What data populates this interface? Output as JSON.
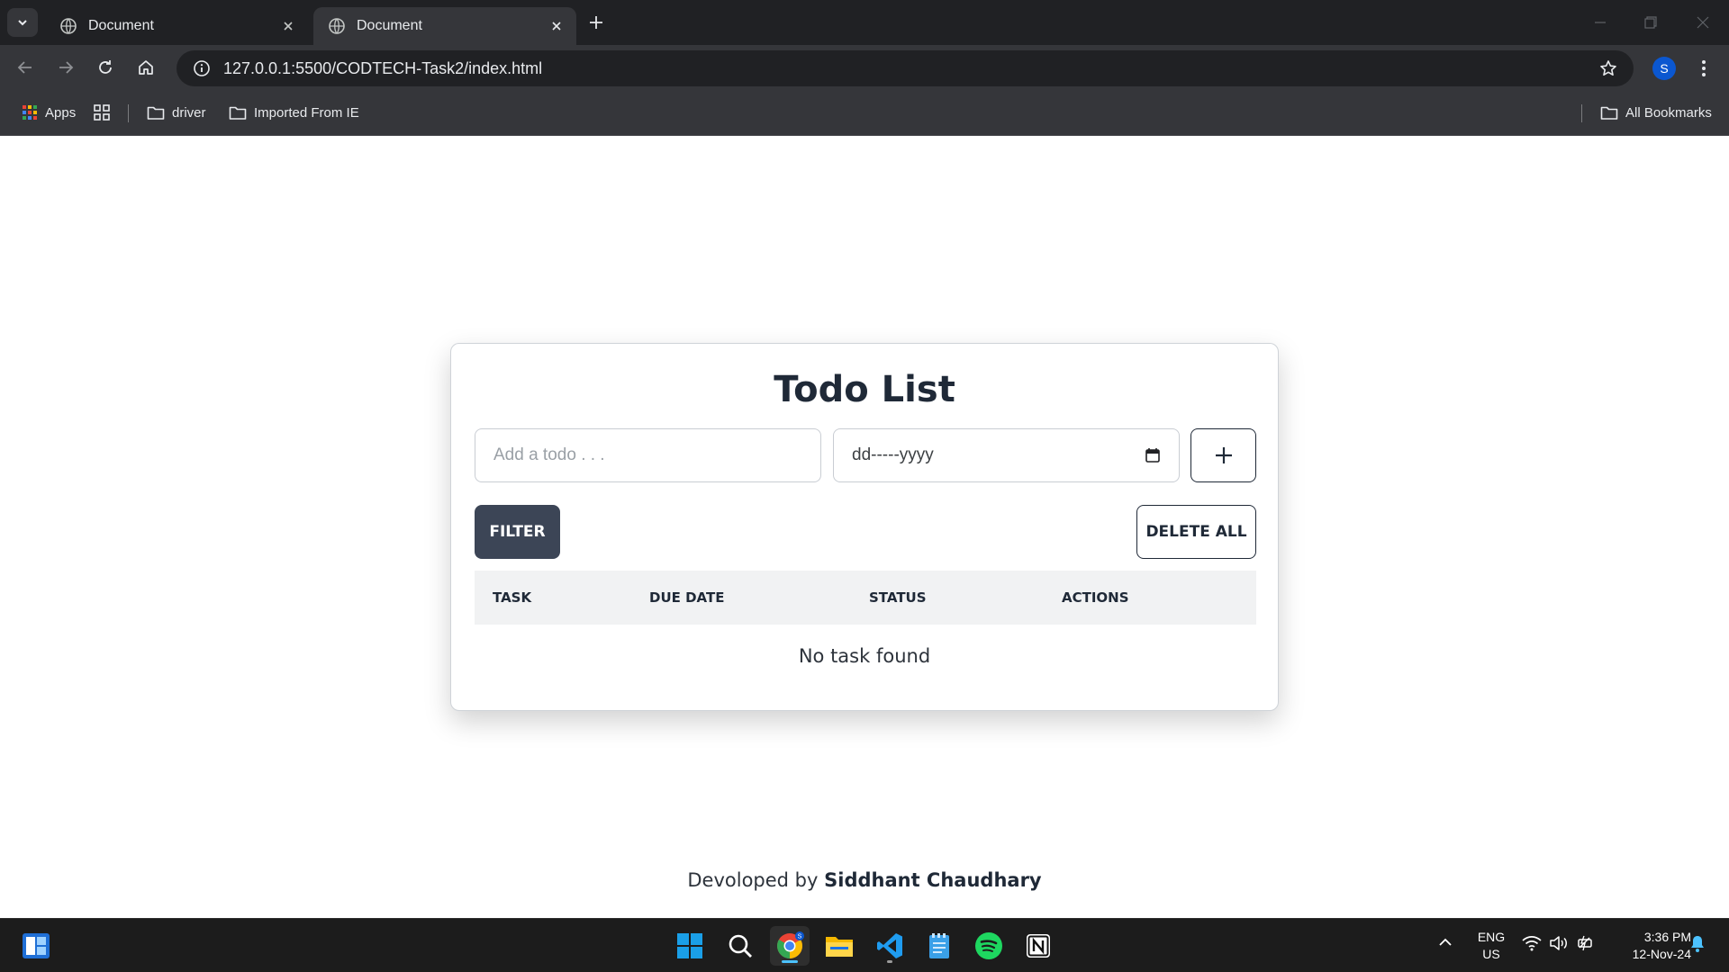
{
  "browser": {
    "tabs": [
      {
        "title": "Document",
        "active": false
      },
      {
        "title": "Document",
        "active": true
      }
    ],
    "url": "127.0.0.1:5500/CODTECH-Task2/index.html",
    "profile_initial": "S",
    "bookmarks": {
      "apps_label": "Apps",
      "items": [
        "driver",
        "Imported From IE"
      ],
      "all_bookmarks_label": "All Bookmarks"
    }
  },
  "app": {
    "title": "Todo List",
    "todo_placeholder": "Add a todo . . .",
    "date_placeholder": "dd-----yyyy",
    "filter_label": "FILTER",
    "delete_all_label": "DELETE ALL",
    "table_headers": [
      "TASK",
      "DUE DATE",
      "STATUS",
      "ACTIONS"
    ],
    "empty_message": "No task found"
  },
  "footer": {
    "prefix": "Devoloped by",
    "author": "Siddhant Chaudhary"
  },
  "taskbar": {
    "pinned": [
      "start-icon",
      "search-icon",
      "chrome-icon",
      "file-explorer-icon",
      "vscode-icon",
      "notepad-icon",
      "spotify-icon",
      "notion-icon"
    ],
    "language": {
      "line1": "ENG",
      "line2": "US"
    },
    "time": "3:36 PM",
    "date": "12-Nov-24"
  }
}
